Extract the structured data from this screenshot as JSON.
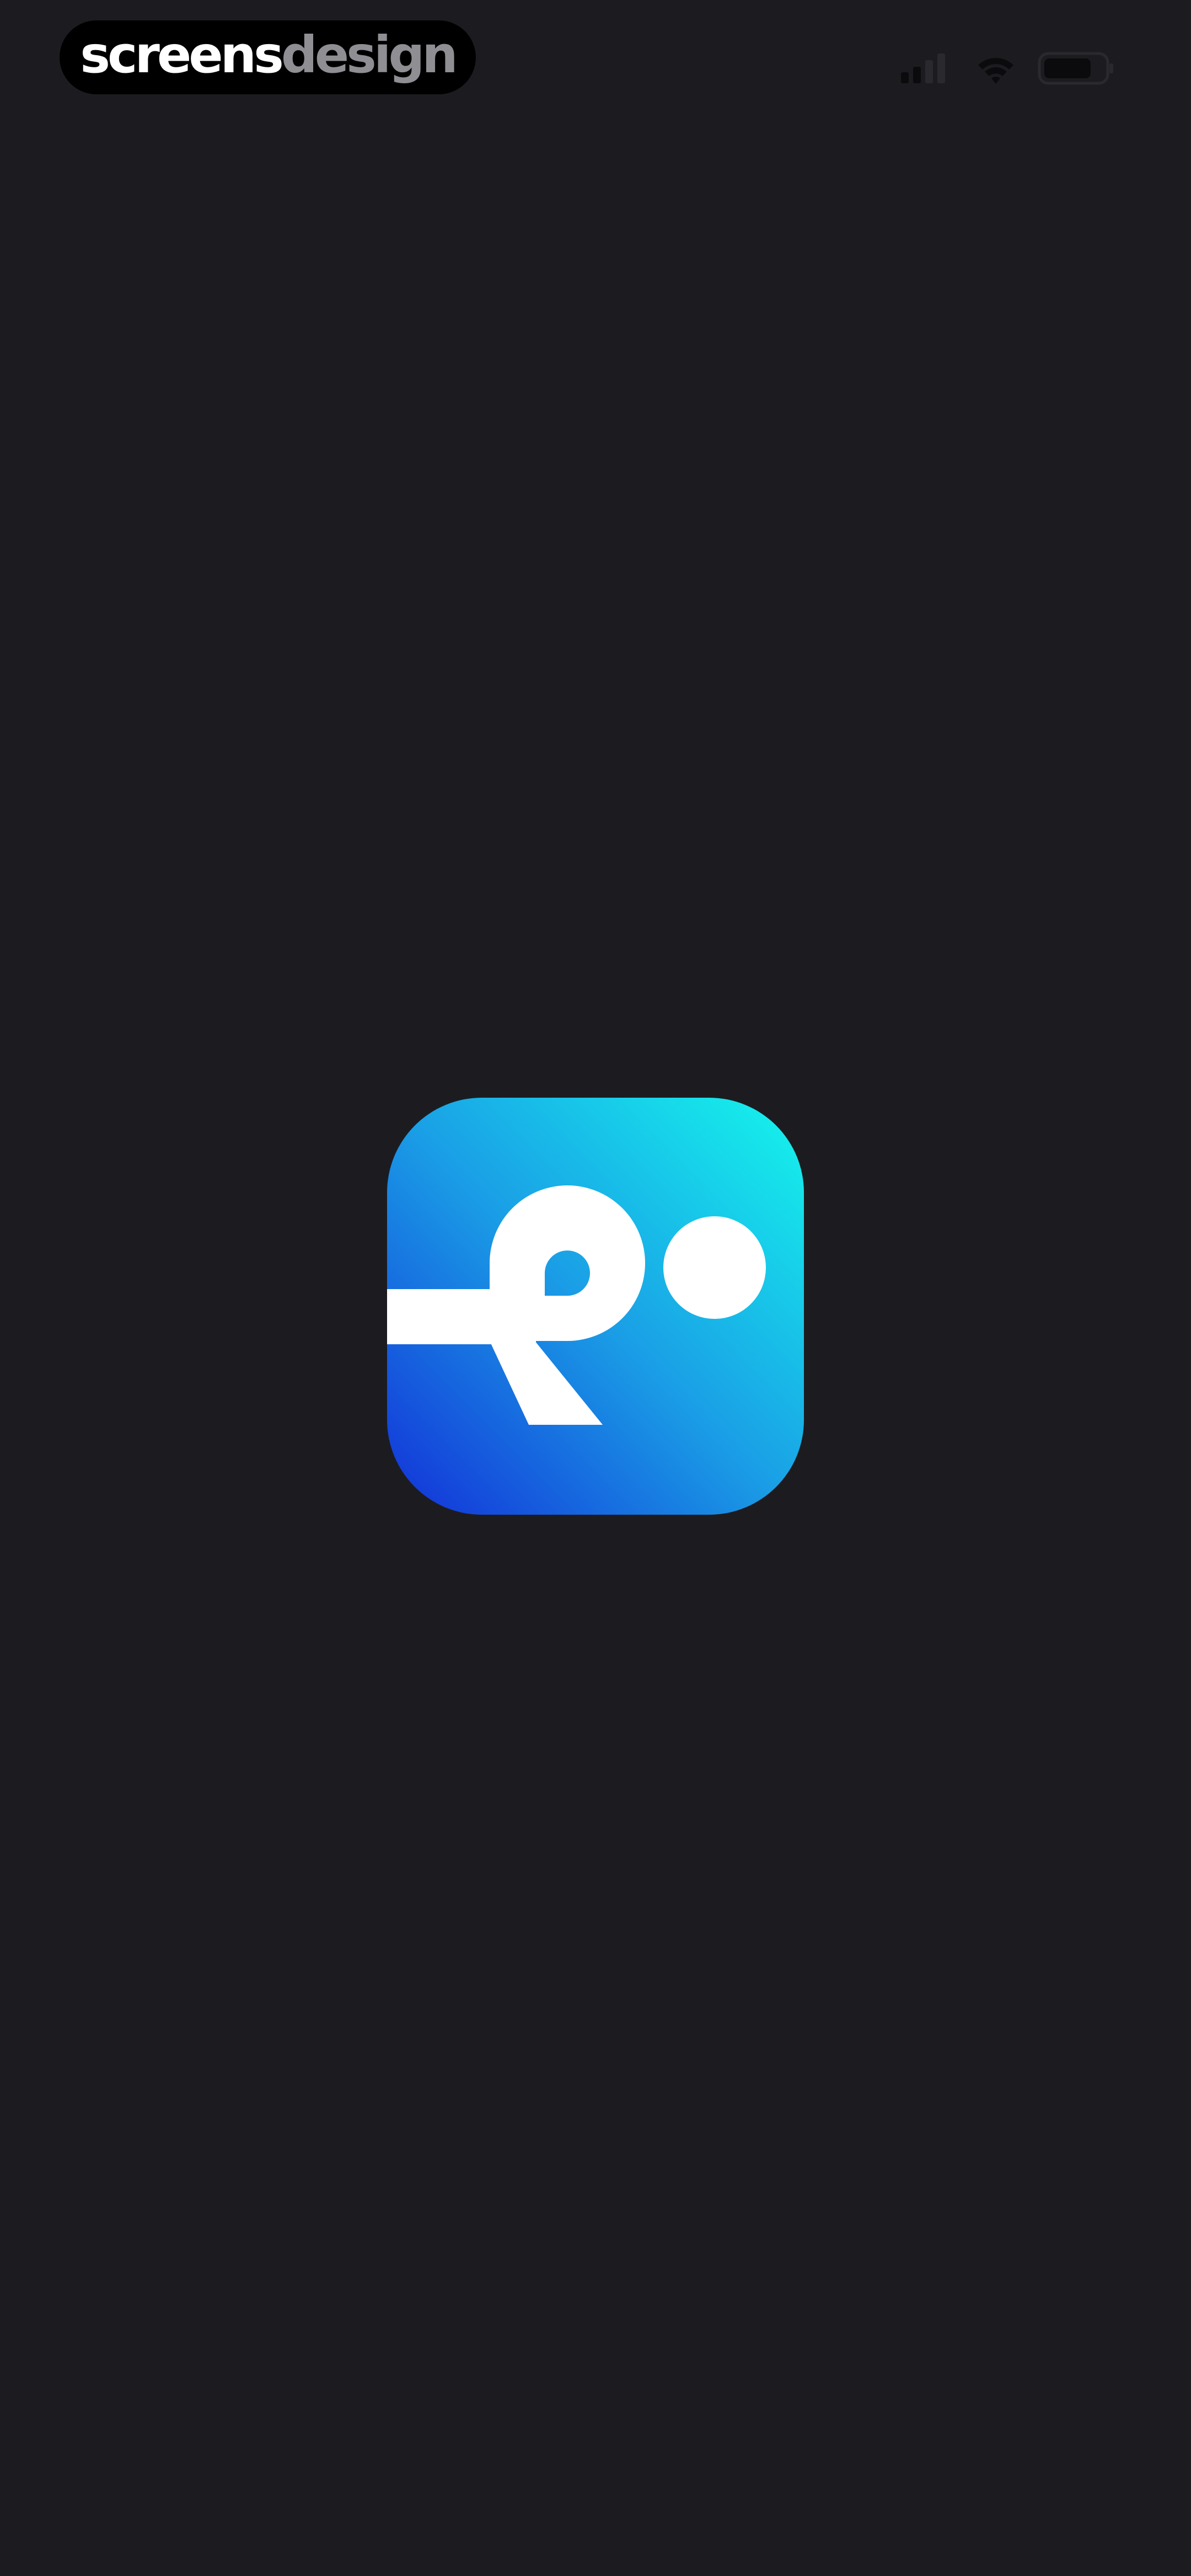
{
  "status_bar": {
    "brand_part1": "screens",
    "brand_part2": "design",
    "icons": [
      "signal-icon",
      "wifi-icon",
      "battery-icon"
    ]
  },
  "splash": {
    "logo_icon": "app-logo-icon",
    "logo_gradient": {
      "start": "#1330d8",
      "mid": "#1a9fe6",
      "end": "#15f6ec"
    },
    "logo_glyph_color": "#ffffff"
  },
  "colors": {
    "background": "#1c1c20",
    "status_pill": "#000000",
    "brand_primary": "#ffffff",
    "brand_secondary": "#8e8e93"
  }
}
